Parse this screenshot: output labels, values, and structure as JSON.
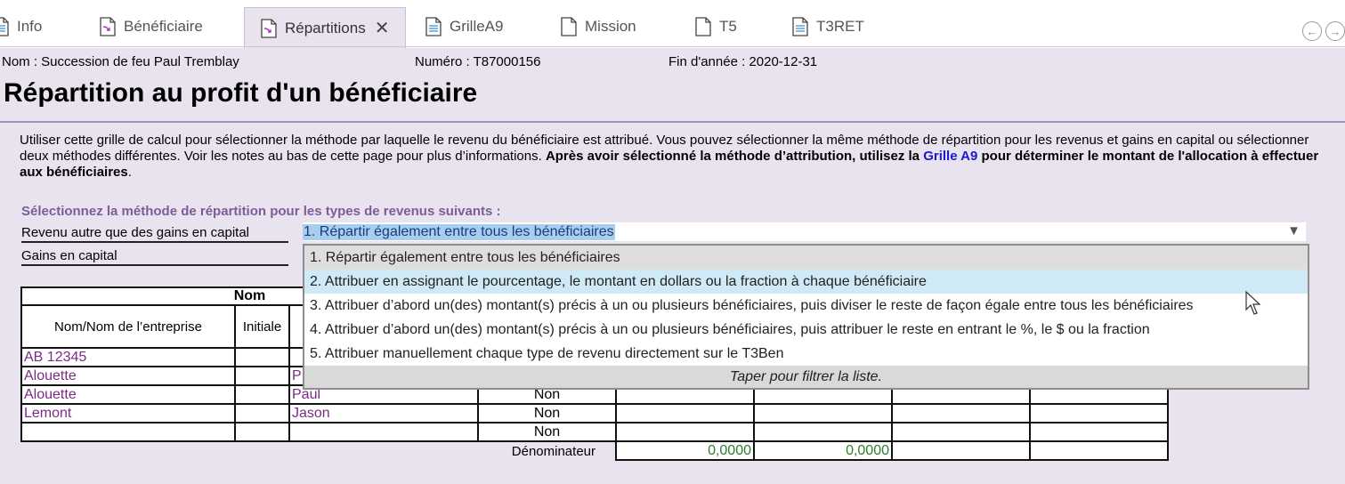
{
  "tabs": [
    {
      "label": "Info",
      "icon": "document-icon"
    },
    {
      "label": "Bénéficiaire",
      "icon": "form-arrow-icon"
    },
    {
      "label": "Répartitions",
      "icon": "form-arrow-icon",
      "active": true
    },
    {
      "label": "GrilleA9",
      "icon": "document-lines-icon"
    },
    {
      "label": "Mission",
      "icon": "document-icon"
    },
    {
      "label": "T5",
      "icon": "document-icon"
    },
    {
      "label": "T3RET",
      "icon": "document-lines-icon"
    }
  ],
  "tab_close": "✕",
  "header": {
    "nom": "Nom : Succession de feu Paul Tremblay",
    "numero": "Numéro : T87000156",
    "fin_annee": "Fin d'année : 2020-12-31",
    "title": "Répartition au profit d'un bénéficiaire"
  },
  "intro": {
    "text": "Utiliser cette grille de calcul pour sélectionner la méthode par laquelle le revenu du bénéficiaire est attribué. Vous pouvez sélectionner la même méthode de répartition pour les revenus et gains en capital ou sélectionner deux méthodes différentes. Voir les notes au bas de cette page pour plus d’informations. ",
    "bold_before": "Après avoir sélectionné la méthode d’attribution, utilisez la ",
    "link": "Grille A9",
    "bold_after": " pour déterminer le montant de l'allocation à effectuer aux bénéficiaires",
    "end": "."
  },
  "section_label": "Sélectionnez la méthode de répartition pour les types de revenus suivants :",
  "fields": {
    "revenu_label": "Revenu autre que des gains en capital",
    "gains_label": "Gains en capital",
    "revenu_value": "1. Répartir également entre tous les bénéficiaires"
  },
  "dropdown": {
    "options": [
      "1. Répartir également entre tous les bénéficiaires",
      "2. Attribuer en assignant le pourcentage, le montant en dollars ou la fraction à chaque bénéficiaire",
      "3. Attribuer d’abord un(des) montant(s) précis à un ou plusieurs bénéficiaires, puis diviser le reste de façon égale entre tous les bénéficiaires",
      "4. Attribuer d’abord un(des) montant(s) précis à un ou plusieurs bénéficiaires, puis attribuer le reste en entrant le %, le $ ou la fraction",
      "5. Attribuer manuellement chaque type de revenu directement sur le T3Ben"
    ],
    "selected_index": 0,
    "hover_index": 1,
    "filter_hint": "Taper pour filtrer la liste."
  },
  "table": {
    "group_header": "Nom",
    "col_entreprise": "Nom/Nom de l’entreprise",
    "col_initiale": "Initiale",
    "rows": [
      {
        "entreprise": "AB 12345",
        "initiale": "",
        "prenom": "",
        "flag": ""
      },
      {
        "entreprise": "Alouette",
        "initiale": "",
        "prenom": "P",
        "flag": ""
      },
      {
        "entreprise": "Alouette",
        "initiale": "",
        "prenom": "Paul",
        "flag": "Non"
      },
      {
        "entreprise": "Lemont",
        "initiale": "",
        "prenom": "Jason",
        "flag": "Non"
      },
      {
        "entreprise": "",
        "initiale": "",
        "prenom": "",
        "flag": "Non"
      }
    ],
    "denominateur_label": "Dénominateur",
    "denominateur_values": [
      "0,0000",
      "0,0000",
      "",
      ""
    ]
  },
  "nav": {
    "back": "←",
    "forward": "→"
  }
}
